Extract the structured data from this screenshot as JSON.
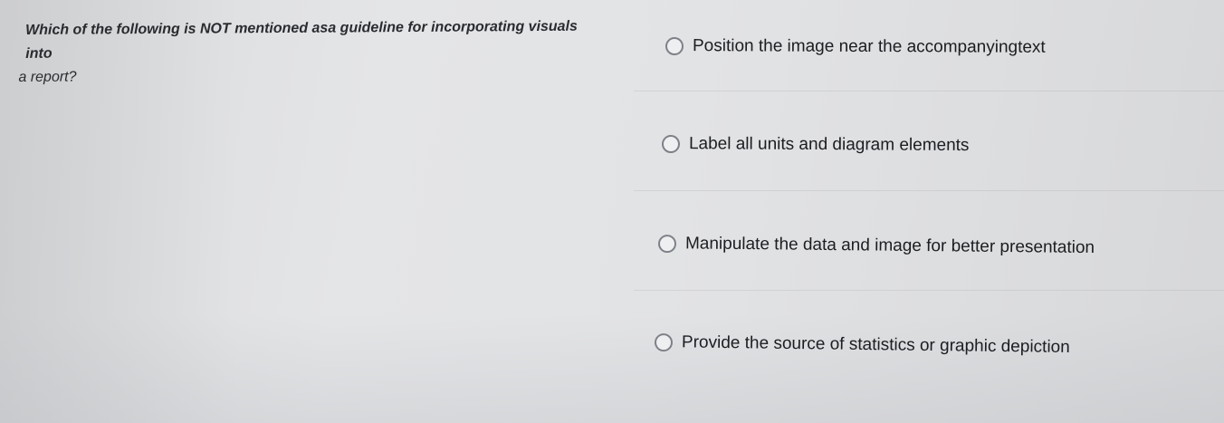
{
  "question": {
    "line1": "Which of the following is NOT mentioned asa guideline for incorporating visuals into",
    "line2": "a report?"
  },
  "options": [
    {
      "label": "Position the image near the accompanyingtext",
      "selected": false
    },
    {
      "label": "Label all units and diagram elements",
      "selected": false
    },
    {
      "label": "Manipulate the data and image for better presentation",
      "selected": false
    },
    {
      "label": "Provide the source of statistics or graphic depiction",
      "selected": false
    }
  ],
  "colors": {
    "background": "#e2e3e5",
    "text": "#1e1f22",
    "radio_border": "#7d8187"
  },
  "icons": {
    "radio": "radio-circle-icon"
  }
}
